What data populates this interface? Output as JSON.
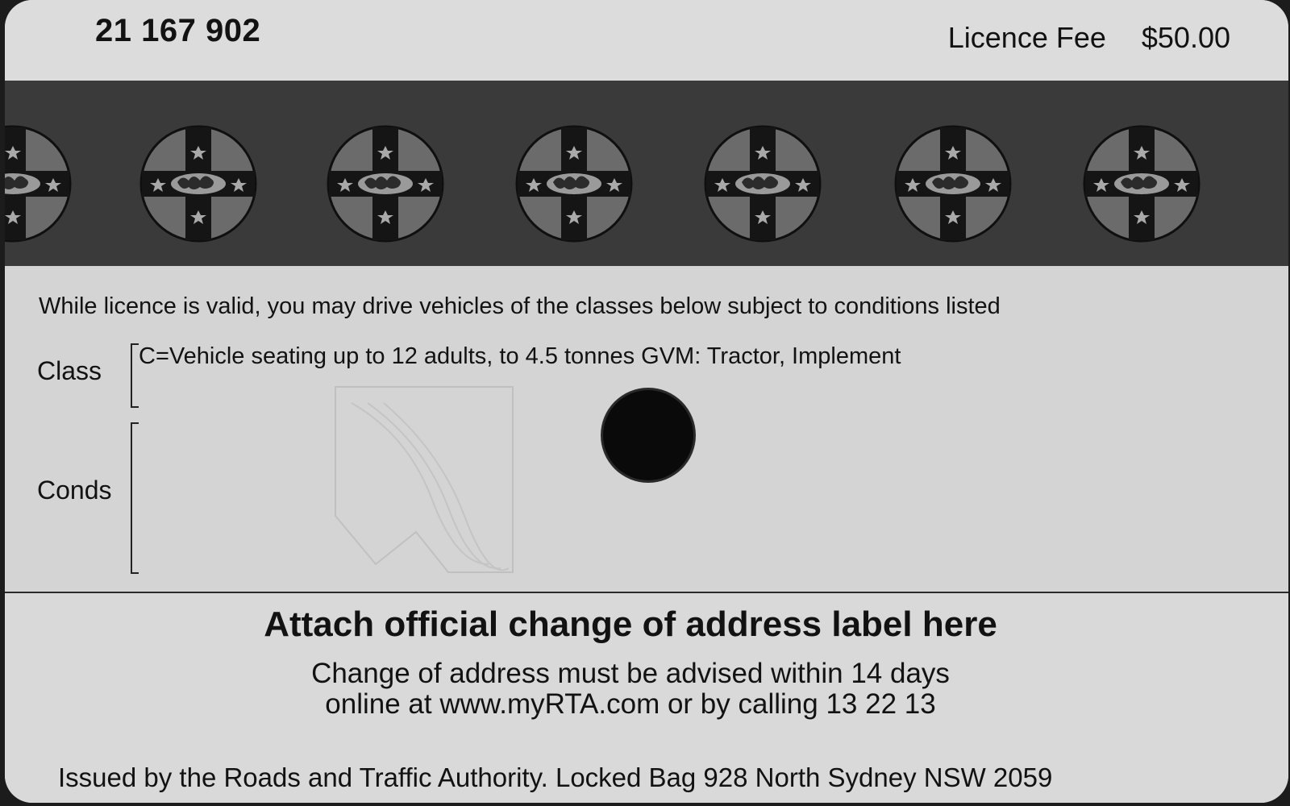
{
  "card": {
    "number": "21 167 902",
    "fee_label": "Licence Fee",
    "fee_value": "$50.00"
  },
  "band": {
    "emblem_icon": "nsw-cross-lion-emblem-icon",
    "background_color": "#3a3a3a"
  },
  "licence": {
    "intro": "While licence is valid, you may drive vehicles of the classes below subject to conditions listed",
    "class_label": "Class",
    "class_value": "C=Vehicle seating up to 12 adults, to 4.5 tonnes GVM: Tractor, Implement",
    "conds_label": "Conds",
    "conds_value": ""
  },
  "address": {
    "heading": "Attach official change of address label here",
    "line1": "Change of address must be advised within 14 days",
    "line2": "online at www.myRTA.com or by calling 13 22 13"
  },
  "footer": {
    "issued_by": "Issued by the Roads and Traffic Authority. Locked Bag 928 North Sydney NSW 2059"
  }
}
